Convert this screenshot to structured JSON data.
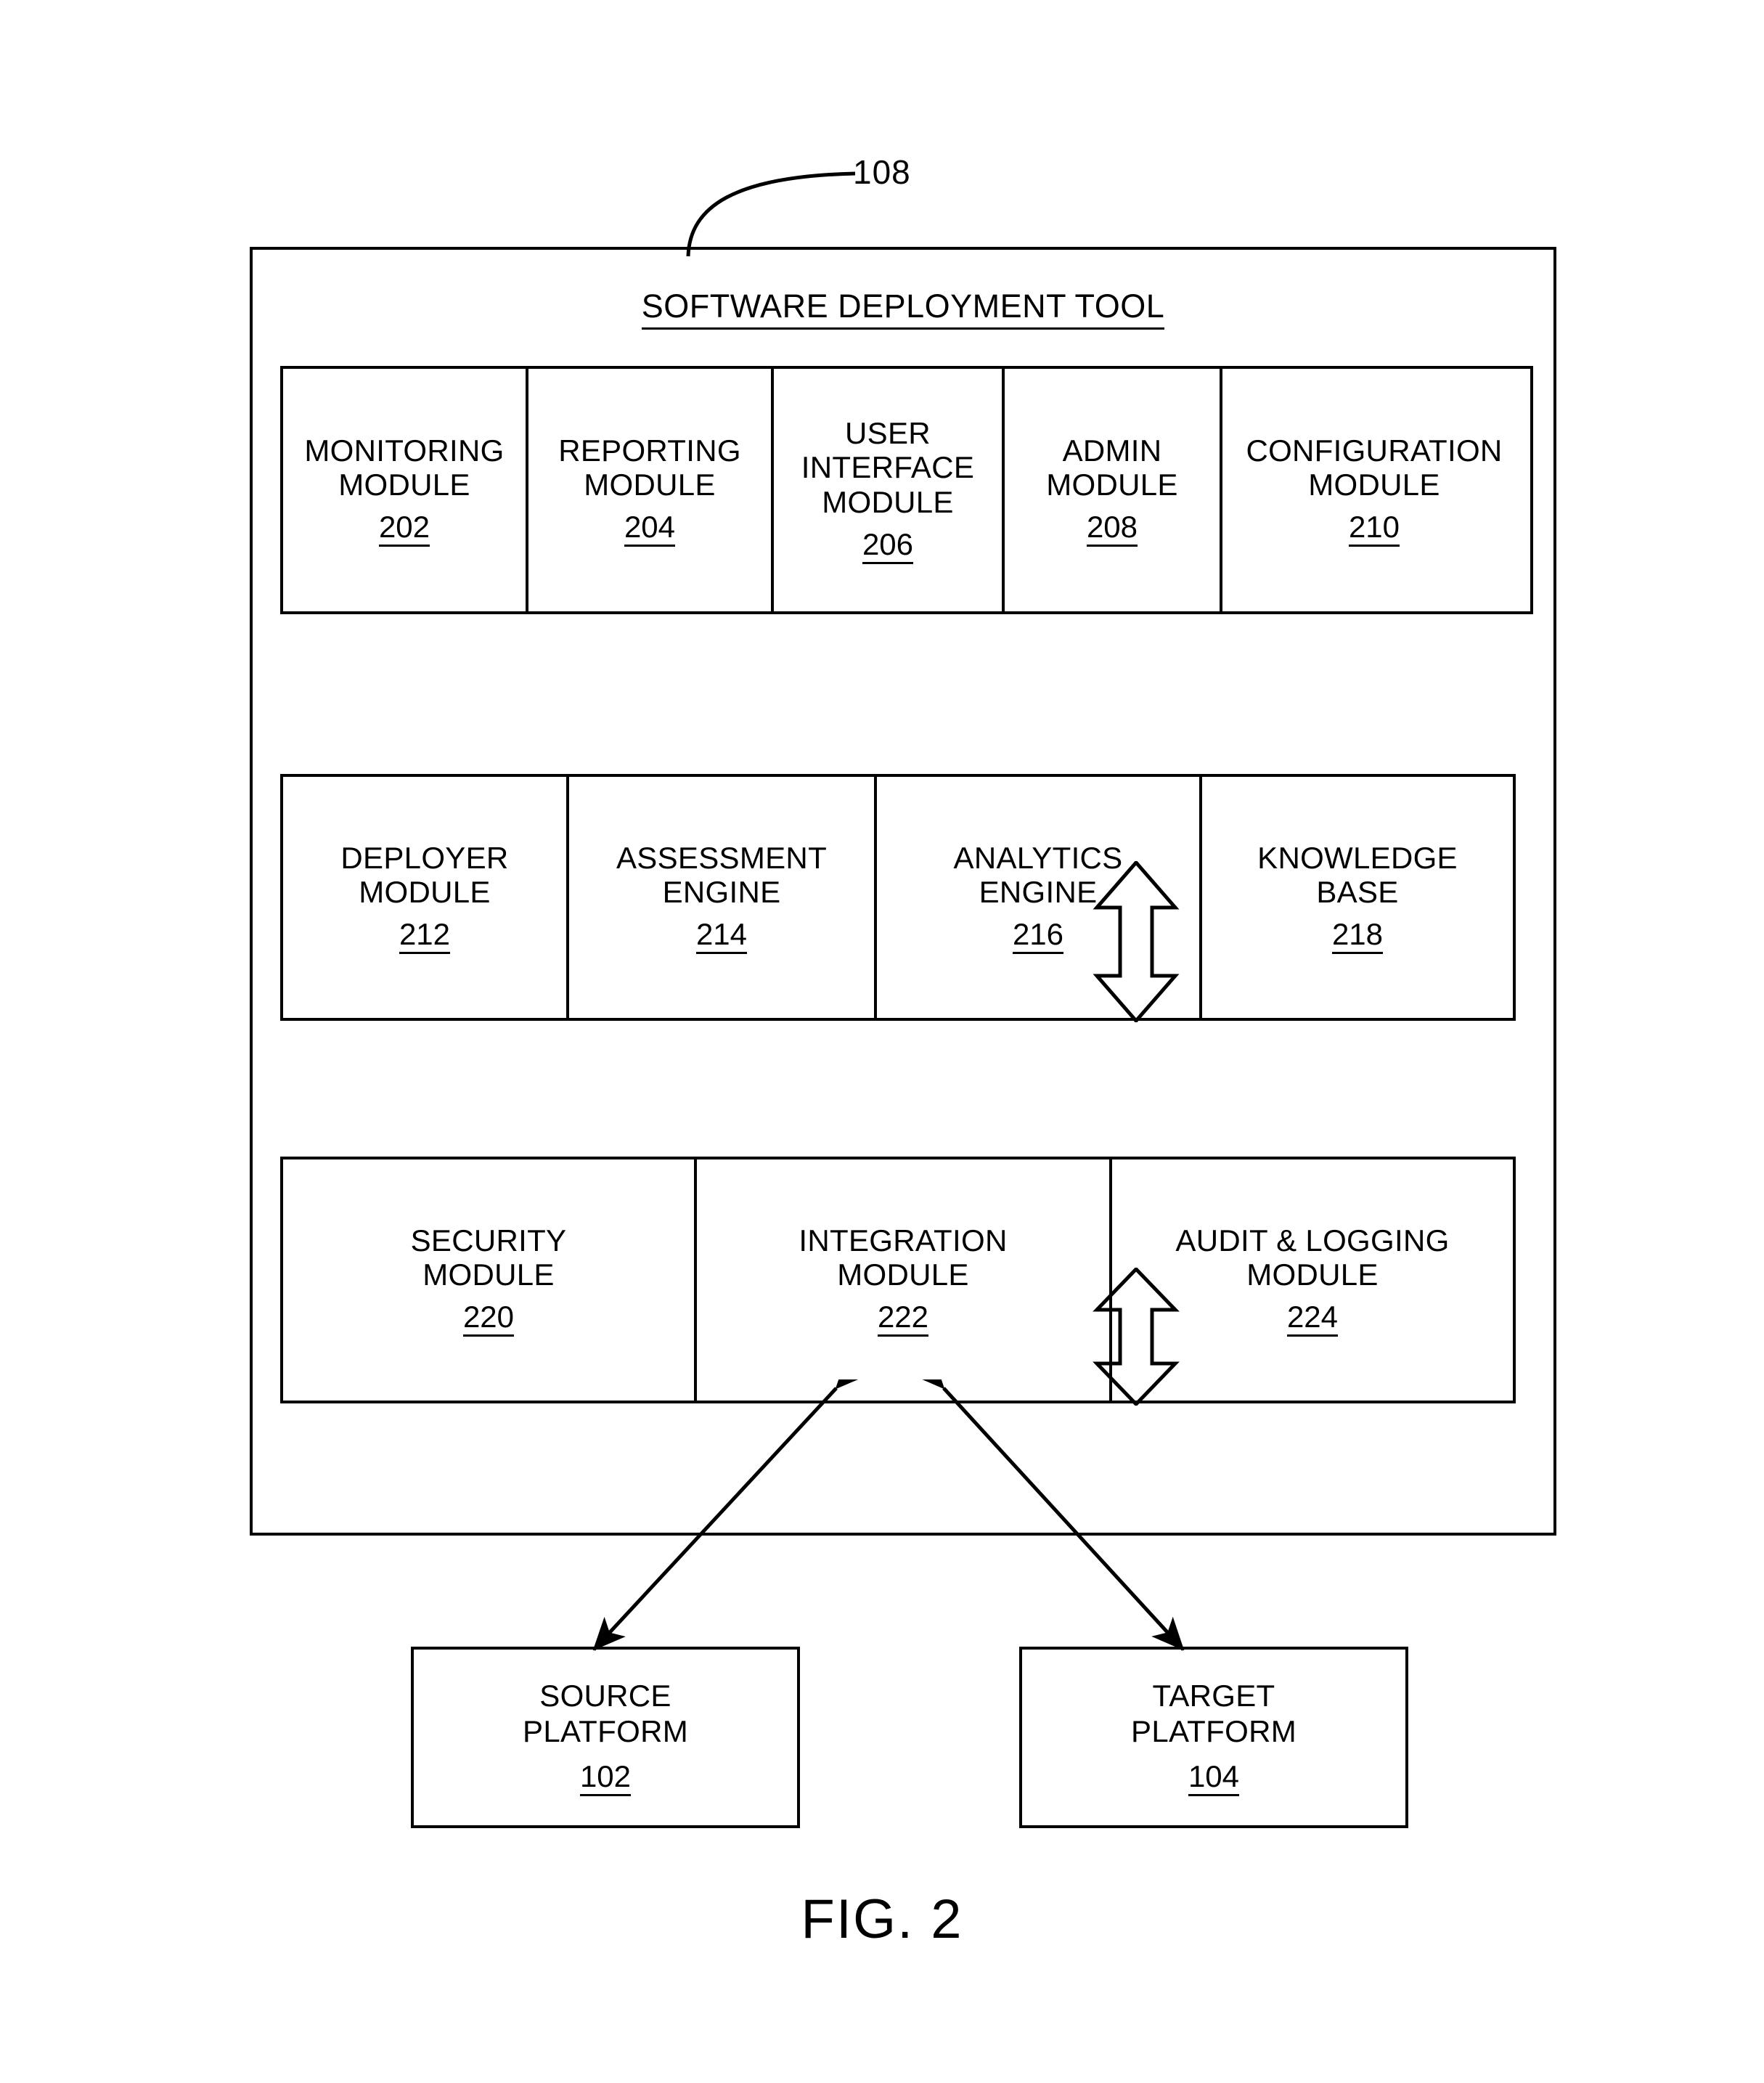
{
  "figure": {
    "caption": "FIG. 2",
    "reference_numeral": "108"
  },
  "tool": {
    "title": "SOFTWARE DEPLOYMENT TOOL",
    "rows": [
      {
        "row_id": "presentation-layer",
        "modules": [
          {
            "name": "MONITORING\nMODULE",
            "ref": "202"
          },
          {
            "name": "REPORTING\nMODULE",
            "ref": "204"
          },
          {
            "name": "USER\nINTERFACE\nMODULE",
            "ref": "206"
          },
          {
            "name": "ADMIN\nMODULE",
            "ref": "208"
          },
          {
            "name": "CONFIGURATION\nMODULE",
            "ref": "210"
          }
        ]
      },
      {
        "row_id": "engine-layer",
        "modules": [
          {
            "name": "DEPLOYER\nMODULE",
            "ref": "212"
          },
          {
            "name": "ASSESSMENT\nENGINE",
            "ref": "214"
          },
          {
            "name": "ANALYTICS\nENGINE",
            "ref": "216"
          },
          {
            "name": "KNOWLEDGE\nBASE",
            "ref": "218"
          }
        ]
      },
      {
        "row_id": "services-layer",
        "modules": [
          {
            "name": "SECURITY\nMODULE",
            "ref": "220"
          },
          {
            "name": "INTEGRATION\nMODULE",
            "ref": "222"
          },
          {
            "name": "AUDIT & LOGGING\nMODULE",
            "ref": "224"
          }
        ]
      }
    ]
  },
  "platforms": [
    {
      "name": "SOURCE\nPLATFORM",
      "ref": "102"
    },
    {
      "name": "TARGET\nPLATFORM",
      "ref": "104"
    }
  ],
  "colors": {
    "stroke": "#000000",
    "background": "#ffffff"
  }
}
